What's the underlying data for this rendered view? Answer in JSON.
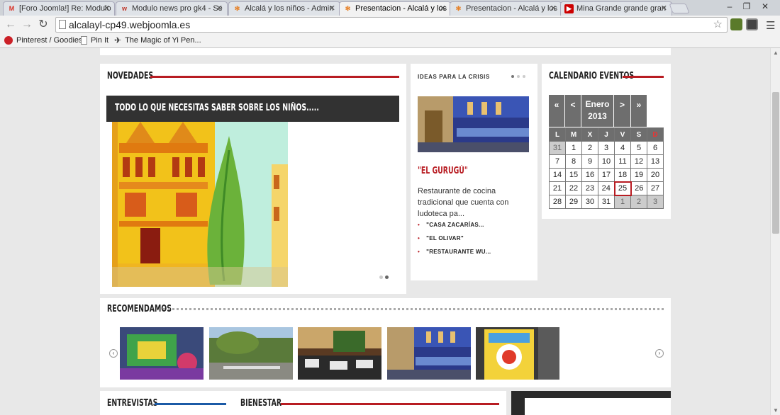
{
  "browser": {
    "tabs": [
      {
        "title": "[Foro Joomla!] Re: Modulo",
        "favicon": "gmail-icon",
        "color": "#d93025"
      },
      {
        "title": "Modulo news pro gk4 - Se",
        "favicon": "web-icon",
        "color": "#c0392b"
      },
      {
        "title": "Alcalá y los niños - Admin",
        "favicon": "joomla-icon",
        "color": "#e67e22"
      },
      {
        "title": "Presentacion - Alcalá y los",
        "favicon": "joomla-icon",
        "color": "#e67e22",
        "active": true
      },
      {
        "title": "Presentacion - Alcalá y los",
        "favicon": "joomla-icon",
        "color": "#e67e22"
      },
      {
        "title": "Mina Grande grande gran",
        "favicon": "youtube-icon",
        "color": "#cc0000"
      }
    ],
    "url": "alcalayl-cp49.webjoomla.es",
    "bookmarks": [
      {
        "label": "Pinterest / Goodies",
        "icon": "pinterest-icon"
      },
      {
        "label": "Pin It",
        "icon": "page-icon"
      },
      {
        "label": "The Magic of Yi Pen...",
        "icon": "plane-icon"
      }
    ],
    "win_minimize": "–",
    "win_restore": "❐",
    "win_close": "✕"
  },
  "novedades": {
    "heading": "NOVEDADES",
    "featured_title": "TODO LO QUE NECESITAS SABER SOBRE LOS NIÑOS....."
  },
  "crisis": {
    "label": "IDEAS PARA LA CRISIS",
    "title": "\"EL GURUGÚ\"",
    "text": "Restaurante de cocina tradicional que cuenta con ludoteca pa...",
    "links": [
      "\"CASA ZACARÍAS...",
      "\"EL OLIVAR\"",
      "\"RESTAURANTE WU..."
    ]
  },
  "calendar": {
    "heading": "CALENDARIO EVENTOS",
    "prev_year": "«",
    "prev_month": "<",
    "month": "Enero",
    "year": "2013",
    "next_month": ">",
    "next_year": "»",
    "weekdays": [
      "L",
      "M",
      "X",
      "J",
      "V",
      "S",
      "D"
    ],
    "weeks": [
      [
        "31",
        "1",
        "2",
        "3",
        "4",
        "5",
        "6"
      ],
      [
        "7",
        "8",
        "9",
        "10",
        "11",
        "12",
        "13"
      ],
      [
        "14",
        "15",
        "16",
        "17",
        "18",
        "19",
        "20"
      ],
      [
        "21",
        "22",
        "23",
        "24",
        "25",
        "26",
        "27"
      ],
      [
        "28",
        "29",
        "30",
        "31",
        "1",
        "2",
        "3"
      ]
    ],
    "today": "25"
  },
  "recomendamos": {
    "heading": "RECOMENDAMOS",
    "prev": "‹",
    "next": "›"
  },
  "bottom": {
    "entrevistas": "ENTREVISTAS",
    "bienestar": "BIENESTAR"
  },
  "colors": {
    "accent_red": "#b81c22",
    "accent_blue": "#1b5aa6",
    "dark": "#323232"
  }
}
